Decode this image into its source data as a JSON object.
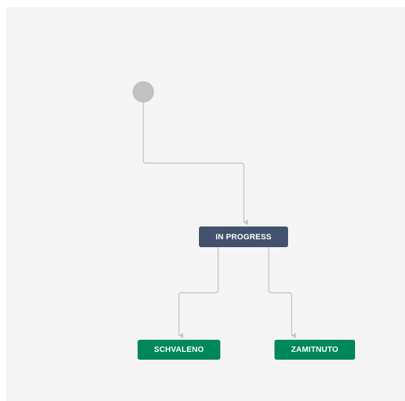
{
  "workflow": {
    "colors": {
      "canvas": "#f4f4f4",
      "start": "#c1c1c1",
      "edge": "#c8c8c8",
      "in_progress": "#42526e",
      "done": "#00875a"
    },
    "statuses": [
      {
        "id": "in_progress",
        "label": "IN PROGRESS",
        "category": "in-progress"
      },
      {
        "id": "schvaleno",
        "label": "SCHVALENO",
        "category": "done"
      },
      {
        "id": "zamitnuto",
        "label": "ZAMITNUTO",
        "category": "done"
      }
    ],
    "transitions": [
      {
        "from": "start",
        "to": "in_progress"
      },
      {
        "from": "in_progress",
        "to": "schvaleno"
      },
      {
        "from": "in_progress",
        "to": "zamitnuto"
      }
    ]
  }
}
